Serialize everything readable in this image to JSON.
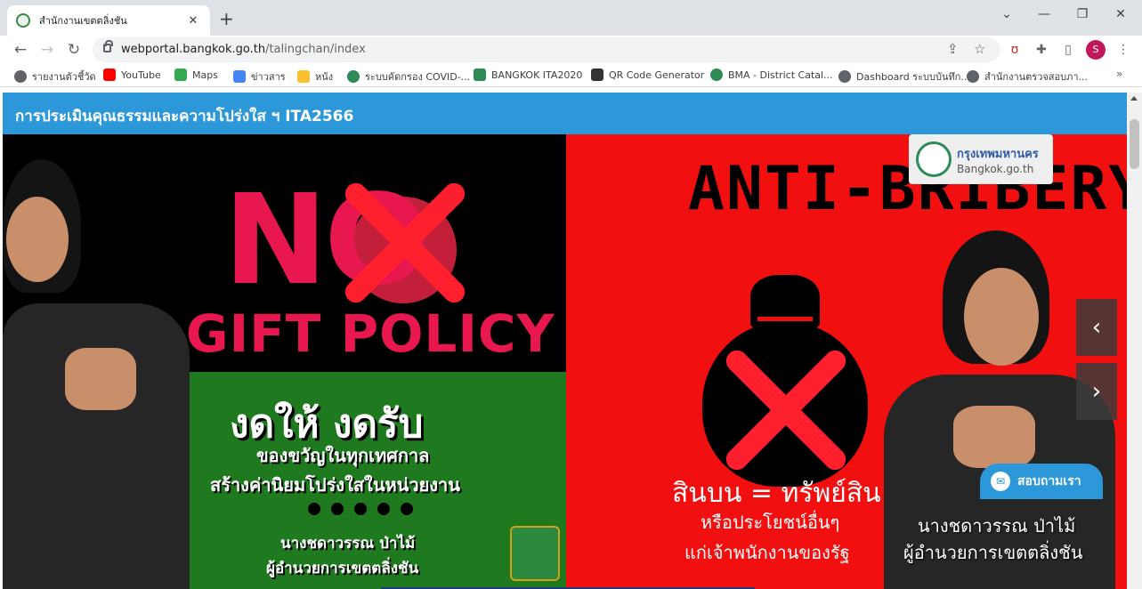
{
  "browser": {
    "tab": {
      "title": "สำนักงานเขตตลิ่งชัน",
      "close": "✕"
    },
    "new_tab": "+",
    "window_controls": {
      "minimize": "—",
      "maximize": "❐",
      "close": "✕",
      "tab_search": "⌄"
    },
    "nav": {
      "back": "←",
      "forward": "→",
      "reload": "↻"
    },
    "url": {
      "host": "webportal.bangkok.go.th",
      "path": "/talingchan/index"
    },
    "profile_initial": "S",
    "icons": [
      "share-icon",
      "star-icon",
      "extension-icon",
      "puzzle-icon",
      "sidepanel-icon",
      "menu-icon"
    ]
  },
  "bookmarks": [
    {
      "label": "รายงานตัวชี้วัด",
      "icon": "globe-icon",
      "color": "#5f6368"
    },
    {
      "label": "YouTube",
      "icon": "youtube-icon",
      "color": "#ff0000"
    },
    {
      "label": "Maps",
      "icon": "maps-icon",
      "color": "#34a853"
    },
    {
      "label": "ข่าวสาร",
      "icon": "news-icon",
      "color": "#4285f4"
    },
    {
      "label": "หนัง",
      "icon": "folder-icon",
      "color": "#fbc02d"
    },
    {
      "label": "ระบบคัดกรอง COVID-...",
      "icon": "bma-icon",
      "color": "#2e8b57"
    },
    {
      "label": "BANGKOK ITA2020",
      "icon": "person-icon",
      "color": "#2e8b57"
    },
    {
      "label": "QR Code Generator",
      "icon": "qr-icon",
      "color": "#333333"
    },
    {
      "label": "BMA - District Catal...",
      "icon": "bma-icon",
      "color": "#2e8b57"
    },
    {
      "label": "Dashboard ระบบบันทึก...",
      "icon": "globe-icon",
      "color": "#5f6368"
    },
    {
      "label": "สำนักงานตรวจสอบภา...",
      "icon": "globe-icon",
      "color": "#5f6368"
    }
  ],
  "bookmarks_more": "»",
  "page": {
    "header": "การประเมินคุณธรรมและความโปร่งใส ฯ ITA2566",
    "hero_left": {
      "no": "NO",
      "gift_policy": "GIFT POLICY",
      "title": "งดให้ งดรับ",
      "line1": "ของขวัญในทุกเทศกาล",
      "line2": "สร้างค่านิยมโปร่งใสในหน่วยงาน",
      "name": "นางชดาวรรณ ป่าไม้",
      "position": "ผู้อำนวยการเขตตลิ่งชัน"
    },
    "hero_right": {
      "logo_th": "กรุงเทพมหานคร",
      "logo_en": "Bangkok.go.th",
      "title": "ANTI-BRIBERY PO",
      "line1": "สินบน = ทรัพย์สิน",
      "line2": "หรือประโยชน์อื่นๆ",
      "line3": "แก่เจ้าพนักงานของรัฐ",
      "name": "นางชดาวรรณ ป่าไม้",
      "position": "ผู้อำนวยการเขตตลิ่งชัน"
    },
    "carousel": {
      "prev": "‹",
      "next": "›"
    },
    "chat_button": "สอบถามเรา"
  }
}
